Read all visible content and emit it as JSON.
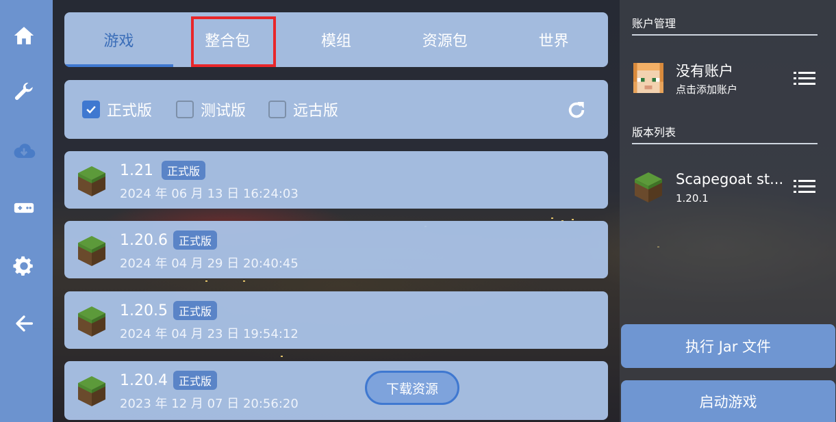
{
  "nav": {
    "items": [
      {
        "name": "home-icon"
      },
      {
        "name": "wrench-icon"
      },
      {
        "name": "cloud-download-icon"
      },
      {
        "name": "gamepad-icon"
      },
      {
        "name": "gear-icon"
      },
      {
        "name": "back-arrow-icon"
      }
    ]
  },
  "tabs": {
    "items": [
      {
        "label": "游戏",
        "active": true
      },
      {
        "label": "整合包",
        "highlighted": true
      },
      {
        "label": "模组"
      },
      {
        "label": "资源包"
      },
      {
        "label": "世界"
      }
    ]
  },
  "filters": {
    "release": {
      "label": "正式版",
      "checked": true
    },
    "snapshot": {
      "label": "测试版",
      "checked": false
    },
    "old": {
      "label": "远古版",
      "checked": false
    }
  },
  "versions": [
    {
      "name": "1.21",
      "badge": "正式版",
      "date": "2024 年 06 月 13 日 16:24:03"
    },
    {
      "name": "1.20.6",
      "badge": "正式版",
      "date": "2024 年 04 月 29 日 20:40:45"
    },
    {
      "name": "1.20.5",
      "badge": "正式版",
      "date": "2024 年 04 月 23 日 19:54:12"
    },
    {
      "name": "1.20.4",
      "badge": "正式版",
      "date": "2023 年 12 月 07 日 20:56:20"
    }
  ],
  "download_button": "下载资源",
  "account": {
    "section_title": "账户管理",
    "name": "没有账户",
    "subtitle": "点击添加账户"
  },
  "instances": {
    "section_title": "版本列表",
    "name": "Scapegoat st...",
    "version": "1.20.1"
  },
  "actions": {
    "run_jar": "执行 Jar 文件",
    "launch": "启动游戏"
  },
  "colors": {
    "nav_bg": "#6c93cf",
    "card_bg": "#aac3e8",
    "accent": "#3f78d0",
    "highlight_box": "#e8262a"
  }
}
